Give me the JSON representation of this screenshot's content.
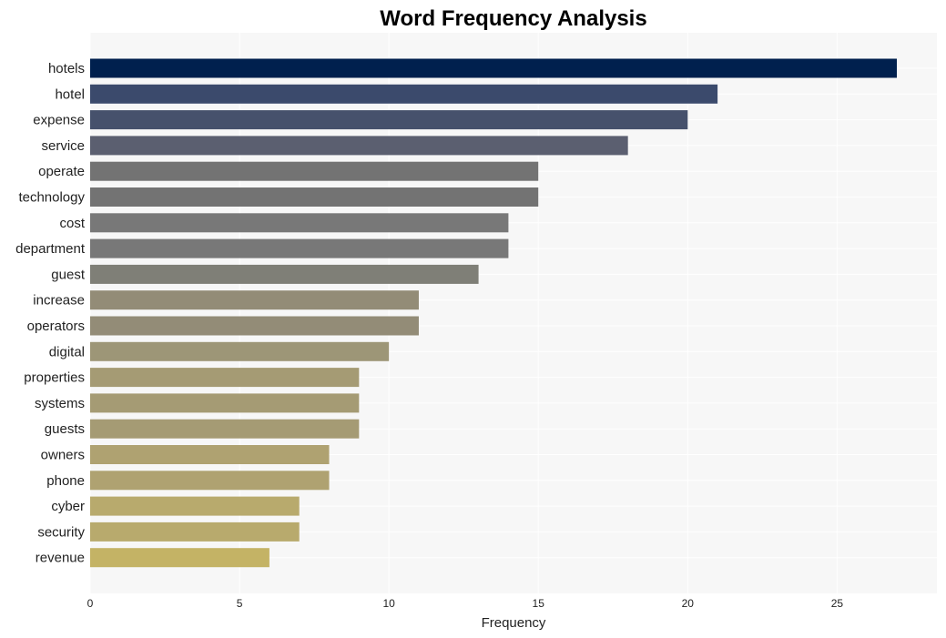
{
  "chart_data": {
    "type": "bar",
    "orientation": "horizontal",
    "title": "Word Frequency Analysis",
    "xlabel": "Frequency",
    "ylabel": "",
    "xlim": [
      0,
      28.35
    ],
    "xticks": [
      0,
      5,
      10,
      15,
      20,
      25
    ],
    "grid": true,
    "categories": [
      "hotels",
      "hotel",
      "expense",
      "service",
      "operate",
      "technology",
      "cost",
      "department",
      "guest",
      "increase",
      "operators",
      "digital",
      "properties",
      "systems",
      "guests",
      "owners",
      "phone",
      "cyber",
      "security",
      "revenue"
    ],
    "values": [
      27,
      21,
      20,
      18,
      15,
      15,
      14,
      14,
      13,
      11,
      11,
      10,
      9,
      9,
      9,
      8,
      8,
      7,
      7,
      6
    ],
    "colors": [
      "#00204e",
      "#3b4a6c",
      "#46516c",
      "#5b5f70",
      "#737373",
      "#737373",
      "#787878",
      "#787878",
      "#7f7f77",
      "#938c77",
      "#938c77",
      "#9d9677",
      "#a59b74",
      "#a59b74",
      "#a59b74",
      "#afa271",
      "#afa271",
      "#b8aa6d",
      "#b8aa6d",
      "#c4b365"
    ],
    "plot_background": "#f7f7f7"
  }
}
